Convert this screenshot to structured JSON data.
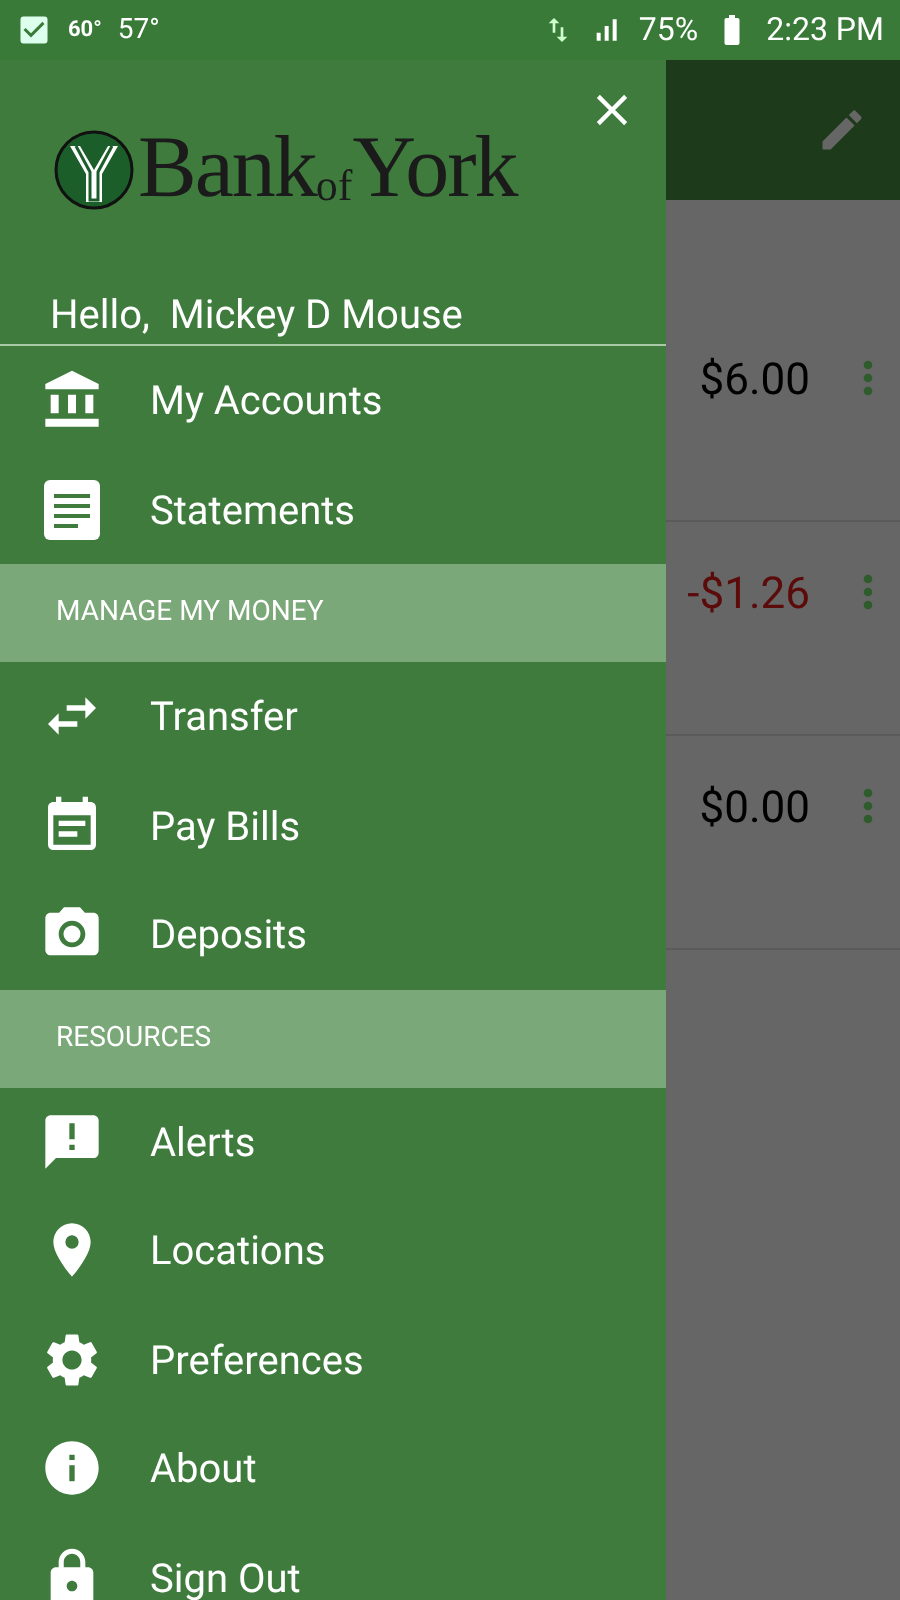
{
  "status_bar": {
    "temp_high": "60°",
    "temp_low": "57°",
    "battery": "75%",
    "time": "2:23 PM"
  },
  "accounts": [
    {
      "amount": "$6.00",
      "color": "#000000"
    },
    {
      "amount": "-$1.26",
      "color": "#5c0b0b"
    },
    {
      "amount": "$0.00",
      "color": "#000000"
    }
  ],
  "drawer": {
    "logo": [
      "Bank",
      "of",
      "York"
    ],
    "greeting": "Hello,  Mickey D Mouse",
    "menu": [
      {
        "kind": "item",
        "label": "My Accounts"
      },
      {
        "kind": "item",
        "label": "Statements"
      },
      {
        "kind": "header",
        "label": "MANAGE MY MONEY"
      },
      {
        "kind": "item",
        "label": "Transfer"
      },
      {
        "kind": "item",
        "label": "Pay Bills"
      },
      {
        "kind": "item",
        "label": "Deposits"
      },
      {
        "kind": "header",
        "label": "RESOURCES"
      },
      {
        "kind": "item",
        "label": "Alerts"
      },
      {
        "kind": "item",
        "label": "Locations"
      },
      {
        "kind": "item",
        "label": "Preferences"
      },
      {
        "kind": "item",
        "label": "About"
      },
      {
        "kind": "item",
        "label": "Sign Out"
      }
    ]
  }
}
